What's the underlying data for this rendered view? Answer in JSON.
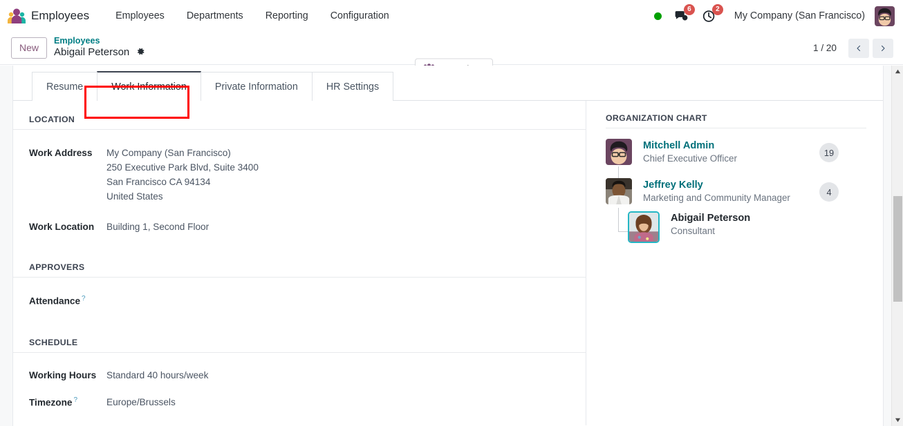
{
  "navbar": {
    "app_logo_icon": "employees-app-icon",
    "app_title": "Employees",
    "menu": [
      {
        "label": "Employees"
      },
      {
        "label": "Departments"
      },
      {
        "label": "Reporting"
      },
      {
        "label": "Configuration"
      }
    ],
    "status_dot_color": "#00a000",
    "messages": {
      "icon": "chat-bubble-icon",
      "count": "6"
    },
    "activities": {
      "icon": "clock-icon",
      "count": "2"
    },
    "company": "My Company (San Francisco)",
    "avatar_icon": "user-avatar"
  },
  "control_panel": {
    "new_label": "New",
    "breadcrumb_parent": "Employees",
    "breadcrumb_current": "Abigail Peterson",
    "gear_icon": "gear-icon",
    "org_chart_button": {
      "label": "Org Chart",
      "icon": "users-group-icon"
    },
    "pager": {
      "text": "1 / 20",
      "prev_icon": "chevron-left-icon",
      "next_icon": "chevron-right-icon"
    }
  },
  "tabs": [
    {
      "label": "Resume",
      "active": false
    },
    {
      "label": "Work Information",
      "active": true,
      "highlighted": true
    },
    {
      "label": "Private Information",
      "active": false
    },
    {
      "label": "HR Settings",
      "active": false
    }
  ],
  "form": {
    "sections": {
      "location": {
        "title": "LOCATION",
        "work_address_label": "Work Address",
        "work_address_lines": [
          "My Company (San Francisco)",
          "250 Executive Park Blvd, Suite 3400",
          "San Francisco CA 94134",
          "United States"
        ],
        "work_location_label": "Work Location",
        "work_location_value": "Building 1, Second Floor"
      },
      "approvers": {
        "title": "APPROVERS",
        "attendance_label": "Attendance",
        "attendance_help": "?",
        "attendance_value": ""
      },
      "schedule": {
        "title": "SCHEDULE",
        "working_hours_label": "Working Hours",
        "working_hours_value": "Standard 40 hours/week",
        "timezone_label": "Timezone",
        "timezone_help": "?",
        "timezone_value": "Europe/Brussels"
      }
    }
  },
  "org_chart": {
    "title": "ORGANIZATION CHART",
    "nodes": [
      {
        "name": "Mitchell Admin",
        "role": "Chief Executive Officer",
        "count": "19",
        "avatar_icon": "avatar-mitchell-admin",
        "current": false
      },
      {
        "name": "Jeffrey Kelly",
        "role": "Marketing and Community Manager",
        "count": "4",
        "avatar_icon": "avatar-jeffrey-kelly",
        "current": false
      },
      {
        "name": "Abigail Peterson",
        "role": "Consultant",
        "count": "",
        "avatar_icon": "avatar-abigail-peterson",
        "current": true
      }
    ]
  },
  "scrollbar": {
    "up_icon": "scroll-up-arrow",
    "down_icon": "scroll-down-arrow"
  },
  "colors": {
    "accent_purple": "#875a7b",
    "teal": "#017e84",
    "highlight_red": "#ff0000",
    "badge_red": "#d9534f",
    "online_green": "#00a000"
  }
}
